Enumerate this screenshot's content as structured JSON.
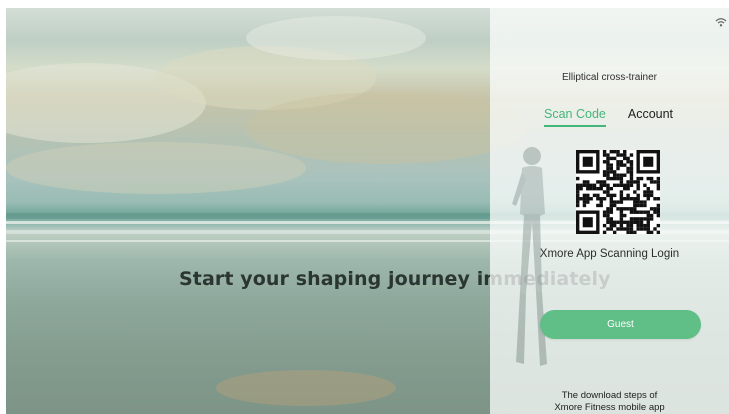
{
  "hero": {
    "headline": "Start your shaping journey immediately"
  },
  "status_bar": {
    "wifi_icon": "wifi-icon"
  },
  "login_panel": {
    "device_name": "Elliptical cross-trainer",
    "tabs": [
      {
        "label": "Scan Code",
        "active": true
      },
      {
        "label": "Account",
        "active": false
      }
    ],
    "qr_icon": "qr-code",
    "scan_label": "Xmore App Scanning Login",
    "guest_button": "Guest",
    "download_line1": "The download steps of",
    "download_line2": "Xmore Fitness mobile app"
  },
  "colors": {
    "accent": "#43b67a",
    "guest_button_bg": "#5fbf86"
  }
}
